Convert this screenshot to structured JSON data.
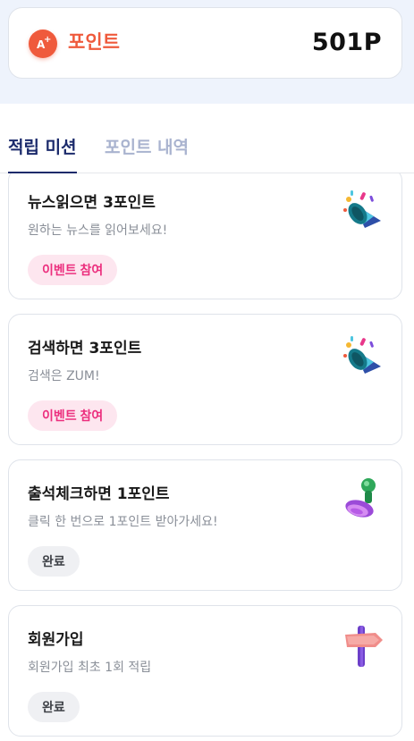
{
  "point": {
    "label": "포인트",
    "value": "501P",
    "icon": "point-badge-icon",
    "icon_letter": "A",
    "accent": "#ef5a3c"
  },
  "tabs": [
    {
      "label": "적립 미션",
      "active": true
    },
    {
      "label": "포인트 내역",
      "active": false
    }
  ],
  "missions": [
    {
      "title": "뉴스읽으면 3포인트",
      "desc": "원하는 뉴스를 읽어보세요!",
      "button": "이벤트 참여",
      "status": "event",
      "icon": "party-popper-icon"
    },
    {
      "title": "검색하면 3포인트",
      "desc": "검색은 ZUM!",
      "button": "이벤트 참여",
      "status": "event",
      "icon": "party-popper-icon"
    },
    {
      "title": "출석체크하면 1포인트",
      "desc": "클릭 한 번으로 1포인트 받아가세요!",
      "button": "완료",
      "status": "done",
      "icon": "stamp-icon"
    },
    {
      "title": "회원가입",
      "desc": "회원가입 최초 1회 적립",
      "button": "완료",
      "status": "done",
      "icon": "signpost-icon"
    }
  ],
  "colors": {
    "tab_active": "#1b2a6b",
    "tab_inactive": "#a9b3cf",
    "event_bg": "#fde6ef",
    "event_text": "#ec2f7e",
    "done_bg": "#eff0f3"
  }
}
